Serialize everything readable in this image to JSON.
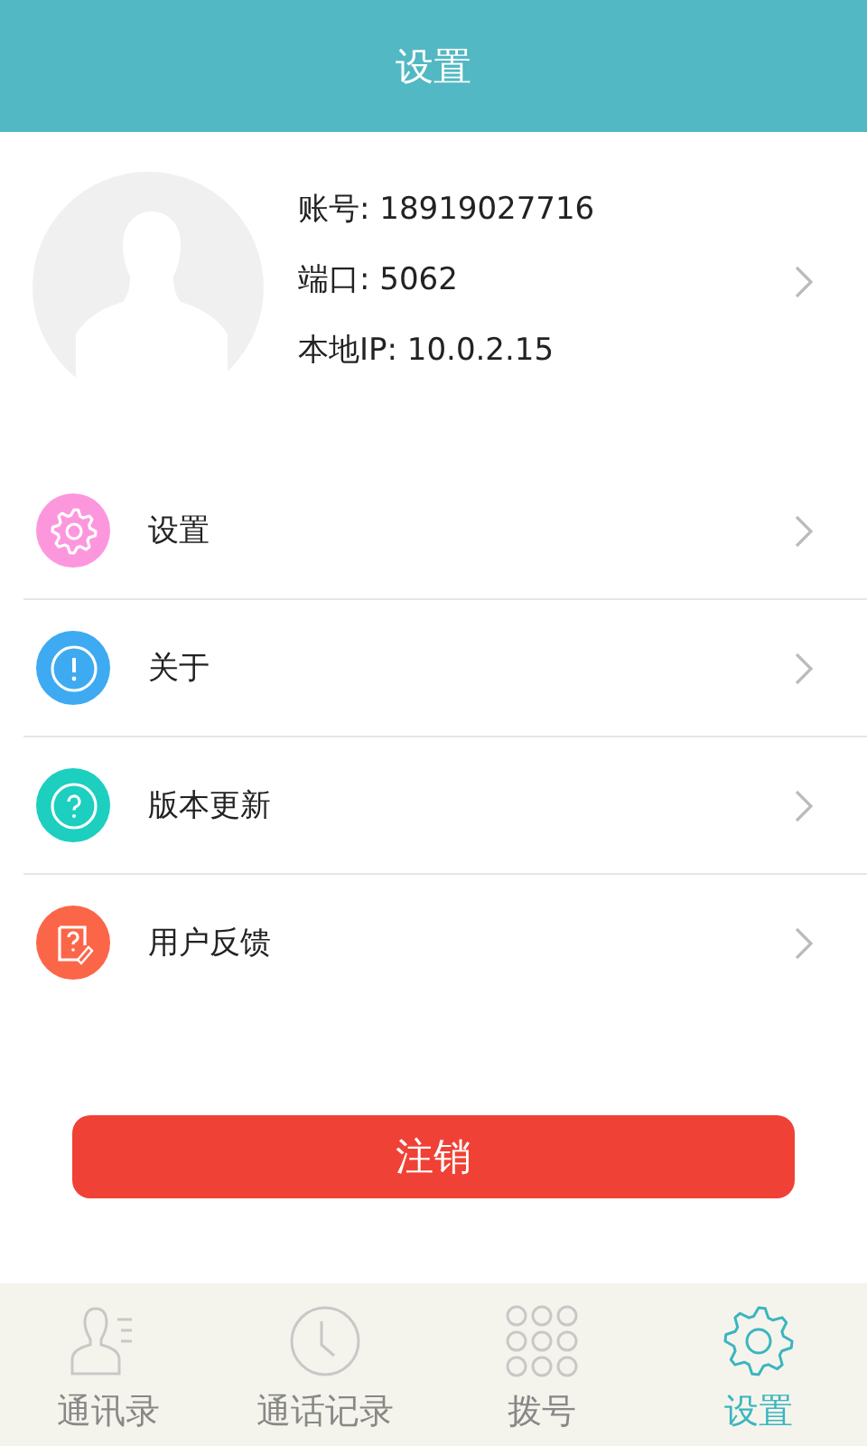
{
  "header": {
    "title": "设置"
  },
  "profile": {
    "lines": [
      {
        "label": "账号:",
        "value": "18919027716"
      },
      {
        "label": "端口:",
        "value": "5062"
      },
      {
        "label": "本地IP:",
        "value": "10.0.2.15"
      }
    ]
  },
  "menu": [
    {
      "kind": "gear",
      "label": "设置",
      "color": "#fc97de"
    },
    {
      "kind": "info",
      "label": "关于",
      "color": "#3eaaf2"
    },
    {
      "kind": "help",
      "label": "版本更新",
      "color": "#1ccfbf"
    },
    {
      "kind": "feedback",
      "label": "用户反馈",
      "color": "#fb6648"
    }
  ],
  "logout_button": "注销",
  "tabs": [
    {
      "kind": "contacts",
      "label": "通讯录",
      "selected": false
    },
    {
      "kind": "history",
      "label": "通话记录",
      "selected": false
    },
    {
      "kind": "dialpad",
      "label": "拨号",
      "selected": false
    },
    {
      "kind": "gear",
      "label": "设置",
      "selected": true
    }
  ]
}
